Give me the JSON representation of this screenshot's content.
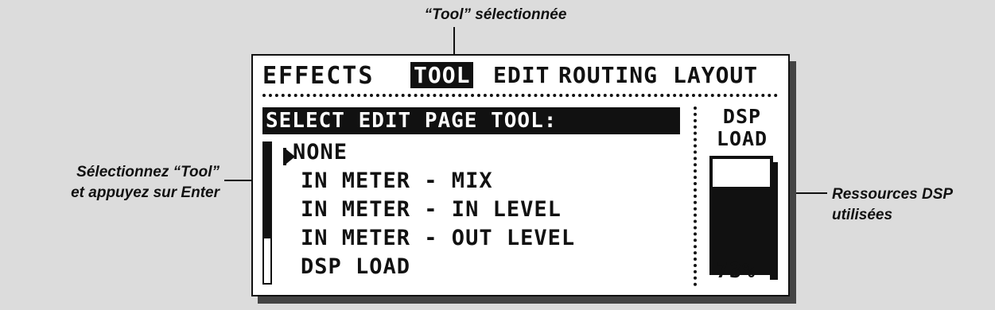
{
  "callouts": {
    "top": "“Tool” sélectionnée",
    "left_line1": "Sélectionnez “Tool”",
    "left_line2": "et appuyez sur Enter",
    "right_line1": "Ressources DSP",
    "right_line2": "utilisées"
  },
  "display": {
    "tabs": [
      "EFFECTS",
      "TOOL",
      "EDIT",
      "ROUTING",
      "LAYOUT"
    ],
    "selected_tab": "TOOL",
    "header": "SELECT EDIT PAGE TOOL:",
    "items": [
      "NONE",
      "IN METER - MIX",
      "IN METER - IN LEVEL",
      "IN METER - OUT LEVEL",
      "DSP LOAD"
    ],
    "selected_item": "NONE",
    "dsp_label_line1": "DSP",
    "dsp_label_line2": "LOAD",
    "dsp_percent_text": "73%",
    "dsp_load_fraction": 0.73
  },
  "colors": {
    "background": "#dcdcdc",
    "ink": "#111111",
    "screen": "#ffffff"
  }
}
